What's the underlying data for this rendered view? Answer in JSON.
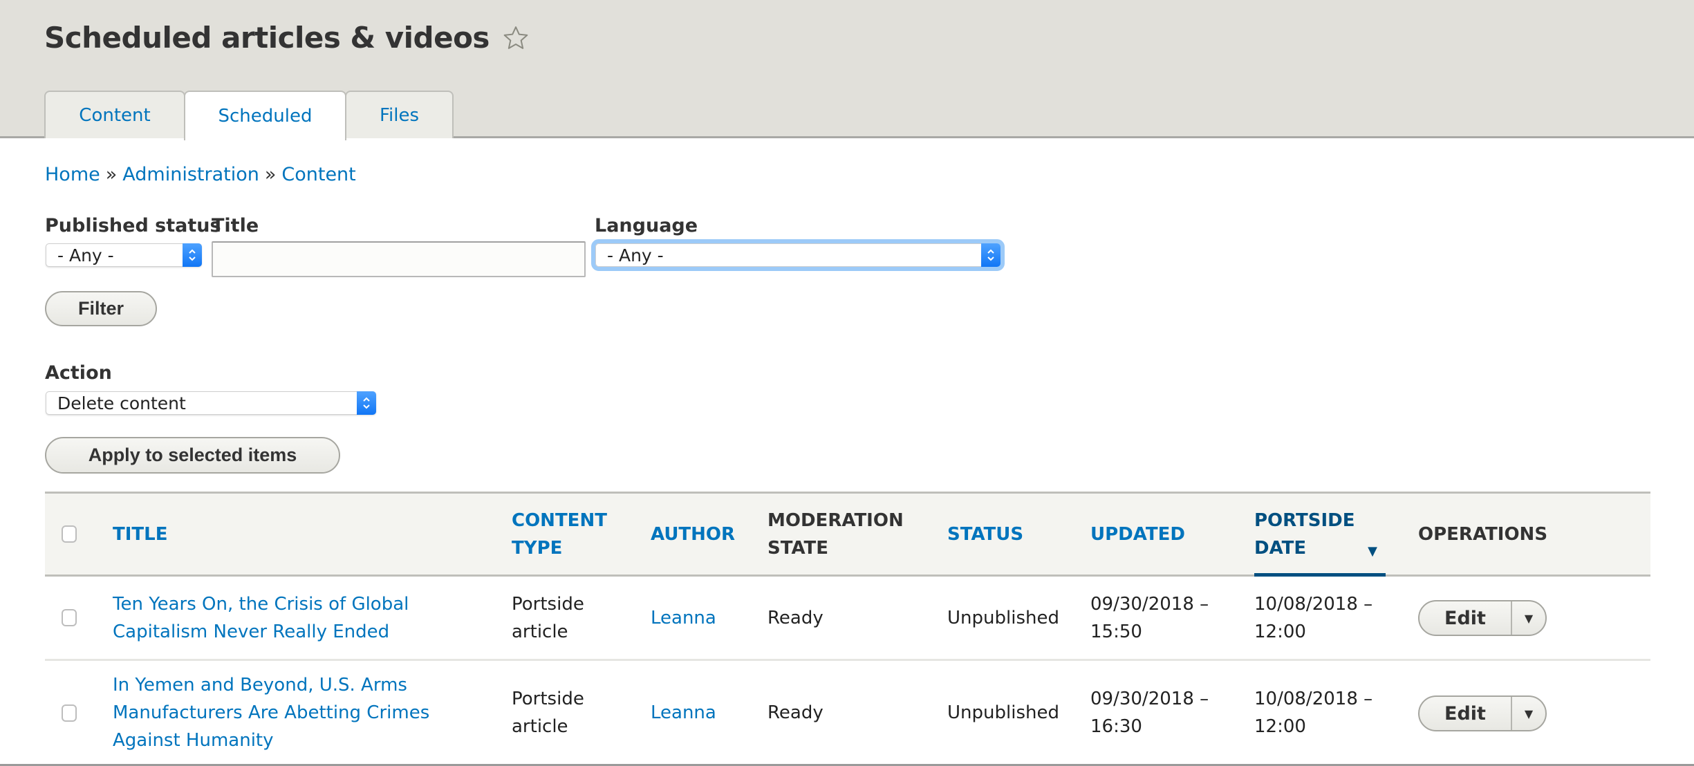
{
  "header": {
    "title": "Scheduled articles & videos",
    "tabs": [
      {
        "label": "Content",
        "active": false
      },
      {
        "label": "Scheduled",
        "active": true
      },
      {
        "label": "Files",
        "active": false
      }
    ]
  },
  "breadcrumb": {
    "items": [
      "Home",
      "Administration",
      "Content"
    ],
    "separator": "»"
  },
  "filters": {
    "published_status": {
      "label": "Published status",
      "value": "- Any -"
    },
    "title": {
      "label": "Title",
      "value": ""
    },
    "language": {
      "label": "Language",
      "value": "- Any -"
    },
    "filter_button": "Filter"
  },
  "action": {
    "label": "Action",
    "value": "Delete content",
    "apply_button": "Apply to selected items"
  },
  "table": {
    "columns": [
      "Title",
      "Content type",
      "Author",
      "Moderation state",
      "Status",
      "Updated",
      "Portside date",
      "Operations"
    ],
    "col_lines": {
      "content_type": [
        "CONTENT",
        "TYPE"
      ],
      "moderation_state": [
        "MODERATION",
        "STATE"
      ],
      "portside_date": [
        "PORTSIDE",
        "DATE"
      ]
    },
    "sorted_column": "Portside date",
    "sort_direction": "desc",
    "rows": [
      {
        "title_lines": [
          "Ten Years On, the Crisis of Global",
          "Capitalism Never Really Ended"
        ],
        "content_type_lines": [
          "Portside",
          "article"
        ],
        "author": "Leanna",
        "moderation_state": "Ready",
        "status": "Unpublished",
        "updated_lines": [
          "09/30/2018 –",
          "15:50"
        ],
        "portside_date_lines": [
          "10/08/2018 –",
          "12:00"
        ],
        "operation": "Edit"
      },
      {
        "title_lines": [
          "In Yemen and Beyond, U.S. Arms",
          "Manufacturers Are Abetting Crimes",
          "Against Humanity"
        ],
        "content_type_lines": [
          "Portside",
          "article"
        ],
        "author": "Leanna",
        "moderation_state": "Ready",
        "status": "Unpublished",
        "updated_lines": [
          "09/30/2018 –",
          "16:30"
        ],
        "portside_date_lines": [
          "10/08/2018 –",
          "12:00"
        ],
        "operation": "Edit"
      }
    ]
  },
  "colors": {
    "link": "#0074bd",
    "sorted_header": "#004f80",
    "header_band": "#e1e0da",
    "table_head": "#f4f4f0",
    "focus_ring": "#9ccaf8"
  }
}
